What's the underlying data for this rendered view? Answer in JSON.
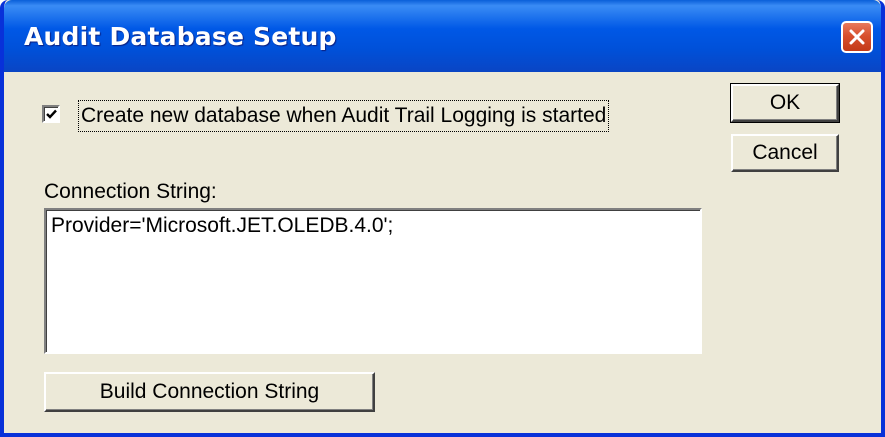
{
  "window": {
    "title": "Audit Database Setup",
    "close_icon": "close-icon"
  },
  "options": {
    "create_new_db_label": "Create new database when Audit Trail Logging is started",
    "create_new_db_checked": true
  },
  "buttons": {
    "ok_label": "OK",
    "cancel_label": "Cancel",
    "build_label": "Build Connection String"
  },
  "connection": {
    "label": "Connection String:",
    "value": "Provider='Microsoft.JET.OLEDB.4.0';"
  },
  "colors": {
    "titlebar": "#0058e6",
    "face": "#ece9d8",
    "close": "#d8502e"
  }
}
